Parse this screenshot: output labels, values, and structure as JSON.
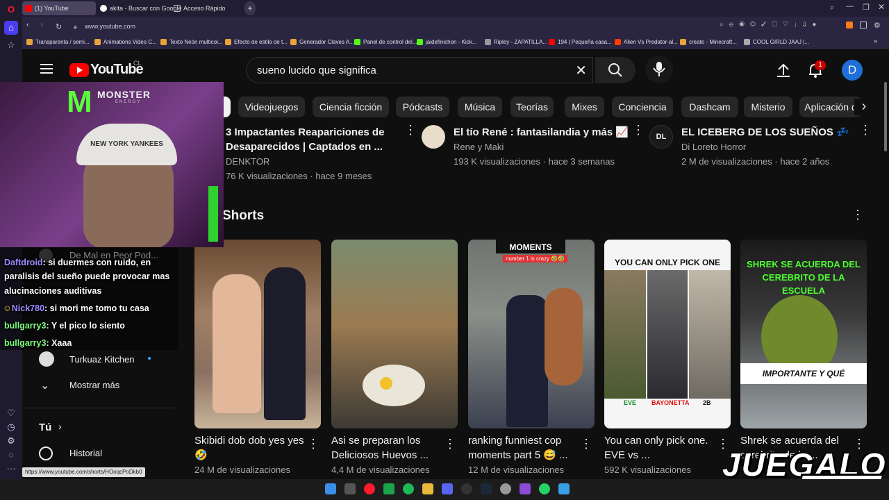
{
  "browser": {
    "tabs": [
      {
        "label": "(1) YouTube"
      },
      {
        "label": "akita - Buscar con Google"
      },
      {
        "label": "Acceso Rápido"
      }
    ],
    "new_tab": "+",
    "url": "www.youtube.com",
    "bookmarks": [
      {
        "label": "Transparenta / semi...",
        "color": "#e8a33a"
      },
      {
        "label": "Animations Video C...",
        "color": "#e8a33a"
      },
      {
        "label": "Texto Neón multicol...",
        "color": "#e8a33a"
      },
      {
        "label": "Efecto de estilo de t...",
        "color": "#e8a33a"
      },
      {
        "label": "Generador Claves A...",
        "color": "#e8a33a"
      },
      {
        "label": "Panel de control del...",
        "color": "#53fc18"
      },
      {
        "label": "jaidefinichon - Kick...",
        "color": "#53fc18"
      },
      {
        "label": "Ripley - ZAPATILLA...",
        "color": "#999999"
      },
      {
        "label": "194 | Pequeña casa...",
        "color": "#ff0000"
      },
      {
        "label": "Alien Vs Predator-al...",
        "color": "#ff3d00"
      },
      {
        "label": "create - Minecraft...",
        "color": "#e8a33a"
      },
      {
        "label": "COOL GIRLD JAAJ |...",
        "color": "#aaaaaa"
      }
    ],
    "status_url": "https://www.youtube.com/shorts/HOoqcPoDkb0"
  },
  "youtube": {
    "logo": "YouTube",
    "country": "CL",
    "search": {
      "value": "sueno lucido que significa"
    },
    "notif_count": "1",
    "avatar": "D",
    "chips": [
      "Videojuegos",
      "Ciencia ficción",
      "Pódcasts",
      "Música",
      "Teorías",
      "Mixes",
      "Conciencia",
      "Dashcam",
      "Misterio",
      "Aplicación d"
    ],
    "videos": [
      {
        "title": "3 Impactantes Reapariciones de Desaparecidos | Captados en ...",
        "channel": "DENKTOR",
        "meta": "76 K visualizaciones · hace 9 meses"
      },
      {
        "title": "El tío René : fantasilandia  y más 📈",
        "channel": "Rene y Maki",
        "meta": "193 K visualizaciones · hace 3 semanas"
      },
      {
        "title": "EL ICEBERG DE LOS SUEÑOS 💤",
        "channel": "Di Loreto Horror",
        "meta": "2 M de visualizaciones · hace 2 años"
      }
    ],
    "shorts_heading": "Shorts",
    "shorts": [
      {
        "title": "Skibidi dob dob yes yes🤣",
        "views": "24 M de visualizaciones"
      },
      {
        "title": "Asi se preparan los Deliciosos Huevos ...",
        "views": "4,4 M de visualizaciones"
      },
      {
        "title": "ranking funniest cop moments part 5 😅 ...",
        "views": "12 M de visualizaciones",
        "thumb_text": "MOMENTS",
        "thumb_text2": "number 1 is crazy 🤣🤣"
      },
      {
        "title": "You can only pick one. EVE vs ...",
        "views": "592 K visualizaciones",
        "thumb_text": "YOU CAN ONLY PICK ONE",
        "labels": [
          "EVE",
          "BAYONETTA",
          "2B"
        ]
      },
      {
        "title": "Shrek se acuerda del cerebrito de la ...",
        "views": "",
        "thumb_text": "SHREK SE ACUERDA DEL CEREBRITO DE LA ESCUELA",
        "thumb_text2": "IMPORTANTE Y QUÉ"
      }
    ],
    "sidebar": {
      "subs": [
        "De Mal en Peor Pod...",
        "Turkuaz Kitchen"
      ],
      "show_more": "Mostrar más",
      "you": "Tú",
      "history": "Historial"
    }
  },
  "overlay": {
    "brand": "MONSTER",
    "brand_sub": "ENERGY",
    "cap_text": "NEW YORK YANKEES",
    "chat": [
      {
        "user": "Daftdroid",
        "msg": ": si duermes con ruido, en"
      },
      {
        "user": "",
        "msg": "paralisis del sueño puede provocar mas"
      },
      {
        "user": "",
        "msg": "alucinaciones auditivas"
      },
      {
        "user": "Nick780",
        "msg": ": si mori me tomo tu casa"
      },
      {
        "user": "bullgarry3",
        "msg": ": Y el pico lo siento"
      },
      {
        "user": "bullgarry3",
        "msg": ": Xaaa"
      }
    ],
    "watermark": "JUEGALO",
    "watermark_sub": ".COM"
  }
}
